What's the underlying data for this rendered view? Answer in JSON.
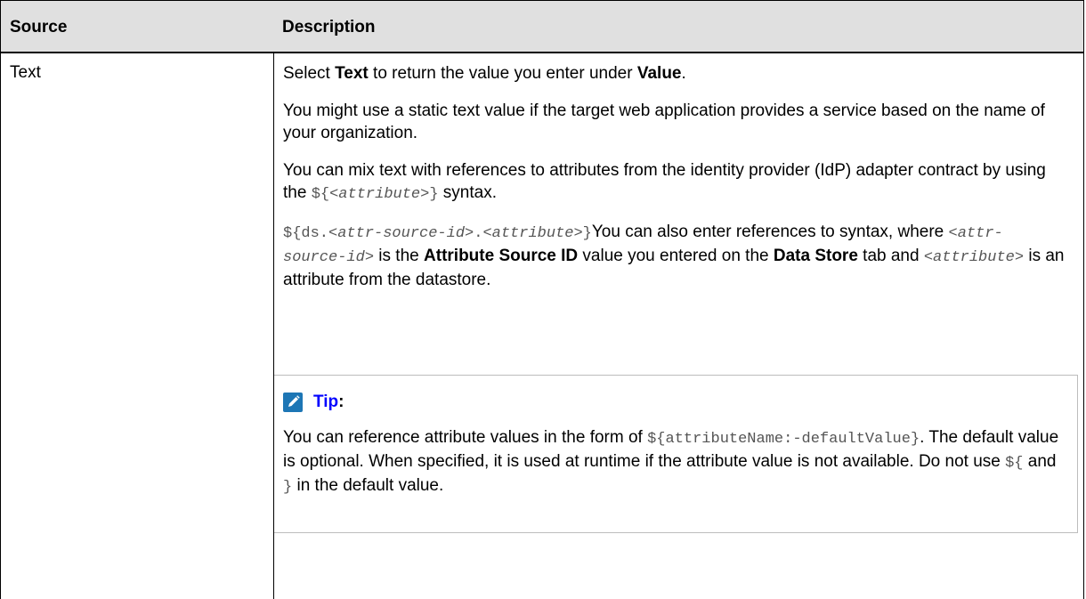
{
  "table": {
    "headers": {
      "source": "Source",
      "description": "Description"
    },
    "row": {
      "source": "Text",
      "p1": {
        "a": "Select ",
        "b": "Text",
        "c": " to return the value you enter under ",
        "d": "Value",
        "e": "."
      },
      "p2": "You might use a static text value if the target web application provides a service based on the name of your organization.",
      "p3": {
        "a": "You can mix text with references to attributes from the identity provider (IdP) adapter contract by using the ",
        "code_open": "${",
        "code_var": "<attribute>",
        "code_close": "}",
        "b": " syntax."
      },
      "p4": {
        "code1_a": "${ds.",
        "code1_b": "<attr-source-id>",
        "code1_c": ".",
        "code1_d": "<attribute>",
        "code1_e": "}",
        "t1": "You can also enter references to syntax, where ",
        "code2": "<attr-source-id>",
        "t2": " is the ",
        "b1": "Attribute Source ID",
        "t3": " value you entered on the ",
        "b2": "Data Store",
        "t4": " tab and ",
        "code3": "<attribute>",
        "t5": " is an attribute from the datastore."
      }
    }
  },
  "tip": {
    "icon": "pencil-icon",
    "label": "Tip",
    "colon": ":",
    "t1": "You can reference attribute values in the form of ",
    "code1": "${attributeName:-defaultValue}",
    "t2": ". The default value is optional. When specified, it is used at runtime if the attribute value is not available. Do not use ",
    "code2": "${",
    "t3": " and ",
    "code3": "}",
    "t4": " in the default value."
  },
  "colors": {
    "header_bg": "#e0e0e0",
    "tip_label": "#0000ff",
    "tip_icon_bg": "#1d76b5",
    "code_text": "#555555"
  }
}
